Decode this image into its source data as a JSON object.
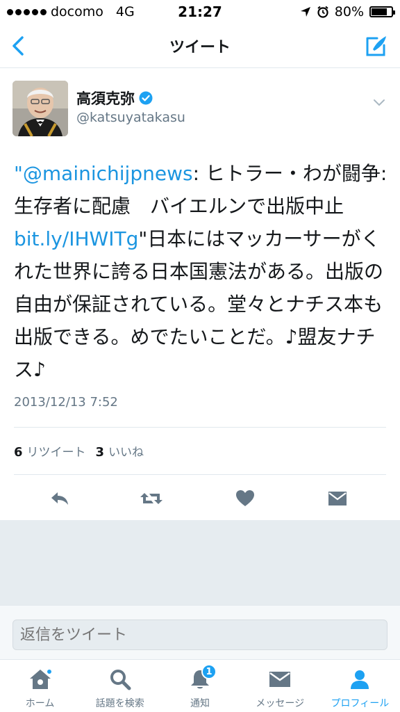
{
  "status_bar": {
    "carrier": "docomo",
    "network": "4G",
    "time": "21:27",
    "battery": "80%",
    "battery_level": 0.8
  },
  "nav": {
    "title": "ツイート"
  },
  "tweet": {
    "user_name": "高須克弥",
    "user_handle": "@katsuyatakasu",
    "text_parts": {
      "p1": "\"",
      "mention": "@mainichijpnews",
      "p2": ": ヒトラー・わが闘争:生存者に配慮　バイエルンで出版中止 ",
      "link": "bit.ly/IHWITg",
      "p3": "\"日本にはマッカーサーがくれた世界に誇る日本国憲法がある。出版の自由が保証されている。堂々とナチス本も出版できる。めでたいことだ。♪盟友ナチス♪"
    },
    "timestamp": "2013/12/13 7:52",
    "retweet_count": "6",
    "retweet_label": "リツイート",
    "like_count": "3",
    "like_label": "いいね"
  },
  "reply": {
    "placeholder": "返信をツイート"
  },
  "tabs": [
    {
      "label": "ホーム"
    },
    {
      "label": "話題を検索"
    },
    {
      "label": "通知",
      "badge": "1"
    },
    {
      "label": "メッセージ"
    },
    {
      "label": "プロフィール"
    }
  ],
  "colors": {
    "accent": "#1da1f2",
    "link": "#1b95e0",
    "icon_gray": "#657786"
  }
}
